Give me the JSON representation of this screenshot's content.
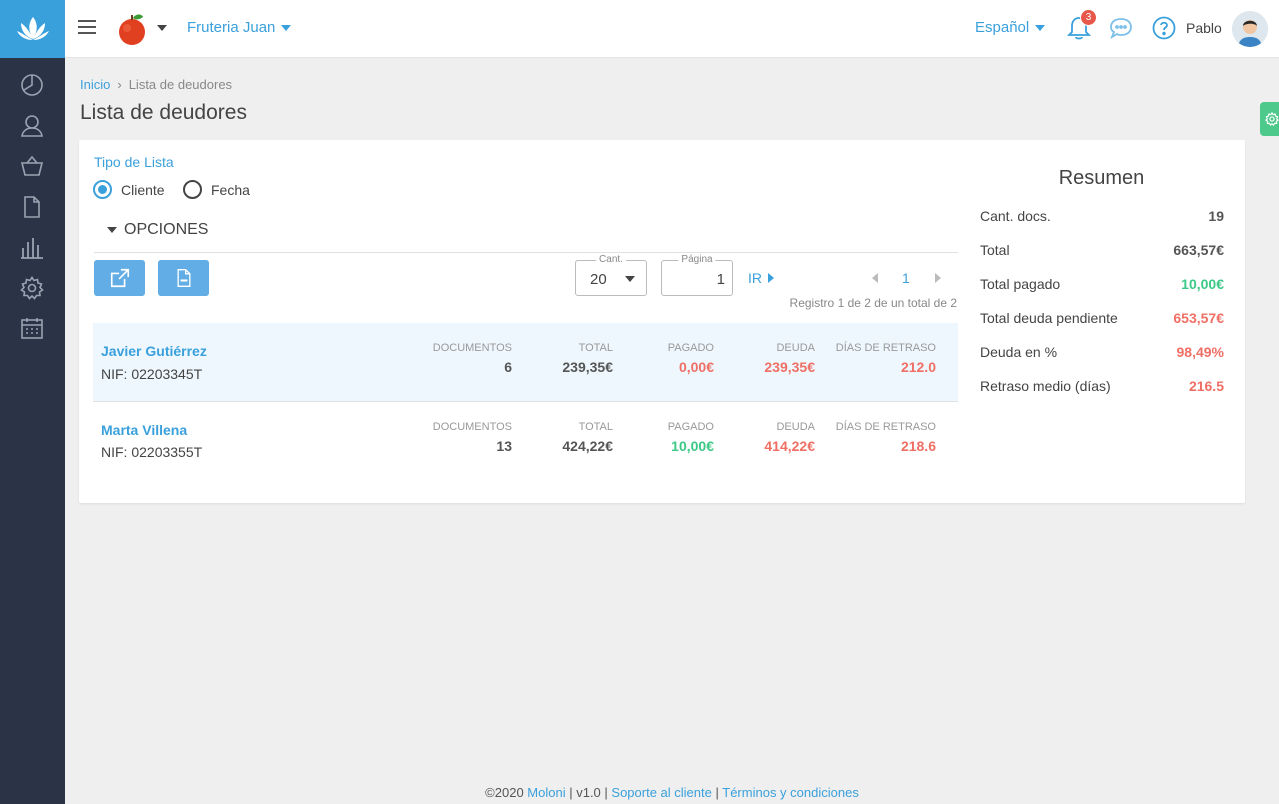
{
  "colors": {
    "accent": "#3aa0dc",
    "sidebar": "#2b3446",
    "red": "#ef6f65",
    "green": "#3cc886",
    "badge": "#e8584a"
  },
  "header": {
    "company": "Fruteria Juan",
    "language": "Español",
    "notifications_count": "3",
    "user_name": "Pablo"
  },
  "sidebar": {
    "items": [
      {
        "icon": "dashboard-icon"
      },
      {
        "icon": "user-icon"
      },
      {
        "icon": "basket-icon"
      },
      {
        "icon": "document-icon"
      },
      {
        "icon": "bar-chart-icon"
      },
      {
        "icon": "gear-icon"
      },
      {
        "icon": "calendar-icon"
      }
    ]
  },
  "breadcrumb": {
    "home": "Inicio",
    "sep": "›",
    "current": "Lista de deudores"
  },
  "page_title": "Lista de deudores",
  "filters": {
    "list_type_label": "Tipo de Lista",
    "option_client": "Cliente",
    "option_date": "Fecha",
    "selected": "Cliente",
    "options_label": "OPCIONES"
  },
  "pagination": {
    "qty_label": "Cant.",
    "qty_value": "20",
    "page_label": "Página",
    "page_value": "1",
    "go_label": "IR",
    "current_page": "1",
    "records_text": "Registro 1 de 2 de un total de 2"
  },
  "table": {
    "headers": {
      "documents": "DOCUMENTOS",
      "total": "TOTAL",
      "paid": "PAGADO",
      "debt": "DEUDA",
      "delay": "DÍAS DE RETRASO"
    },
    "rows": [
      {
        "name": "Javier Gutiérrez",
        "nif": "NIF: 02203345T",
        "documents": "6",
        "total": "239,35€",
        "paid": "0,00€",
        "debt": "239,35€",
        "delay": "212.0"
      },
      {
        "name": "Marta Villena",
        "nif": "NIF: 02203355T",
        "documents": "13",
        "total": "424,22€",
        "paid": "10,00€",
        "debt": "414,22€",
        "delay": "218.6"
      }
    ]
  },
  "summary": {
    "title": "Resumen",
    "items": [
      {
        "label": "Cant. docs.",
        "value": "19"
      },
      {
        "label": "Total",
        "value": "663,57€"
      },
      {
        "label": "Total pagado",
        "value": "10,00€"
      },
      {
        "label": "Total deuda pendiente",
        "value": "653,57€"
      },
      {
        "label": "Deuda en %",
        "value": "98,49%"
      },
      {
        "label": "Retraso medio (días)",
        "value": "216.5"
      }
    ]
  },
  "footer": {
    "copyright": "©2020",
    "brand": "Moloni",
    "version": "| v1.0 |",
    "support": "Soporte al cliente",
    "sep": "|",
    "terms": "Términos y condiciones"
  }
}
